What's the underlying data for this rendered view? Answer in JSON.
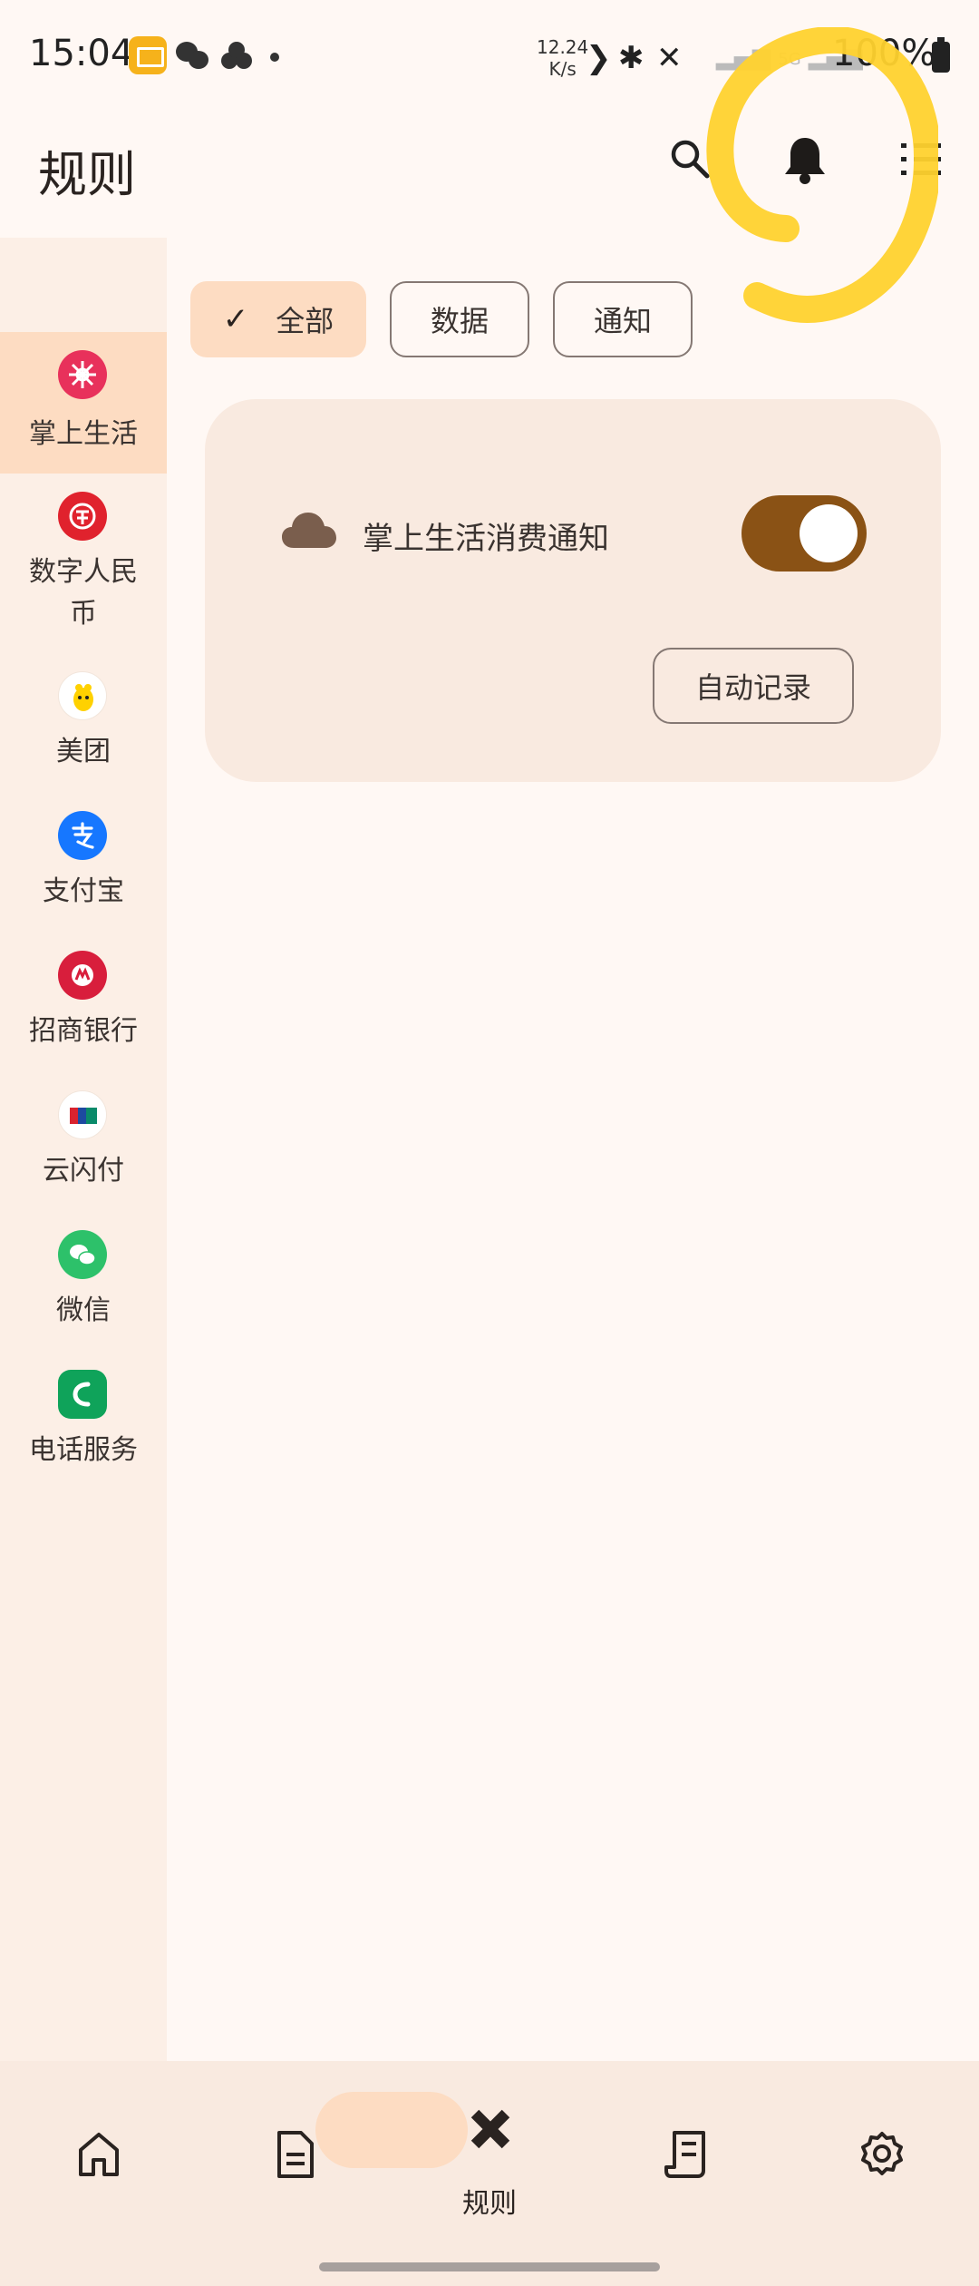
{
  "status_bar": {
    "time": "15:04",
    "speed_value": "12.24",
    "speed_unit": "K/s",
    "battery": "100%",
    "signal": "5G"
  },
  "header": {
    "title": "规则",
    "icons": [
      "search-icon",
      "bell-icon",
      "more-icon"
    ]
  },
  "sidebar": {
    "items": [
      {
        "label": "掌上生活",
        "icon": "zhangshang-icon",
        "color": "#e8315b"
      },
      {
        "label": "数字人民币",
        "icon": "ecny-icon",
        "color": "#e0222d"
      },
      {
        "label": "美团",
        "icon": "meituan-icon",
        "color": "#ffd100"
      },
      {
        "label": "支付宝",
        "icon": "alipay-icon",
        "color": "#1677ff"
      },
      {
        "label": "招商银行",
        "icon": "cmb-icon",
        "color": "#d81e3c"
      },
      {
        "label": "云闪付",
        "icon": "unionpay-icon",
        "color": "#d9232e"
      },
      {
        "label": "微信",
        "icon": "wechat-icon",
        "color": "#2dc16a"
      },
      {
        "label": "电话服务",
        "icon": "phone-icon",
        "color": "#0fa35a"
      }
    ]
  },
  "filters": {
    "all": "全部",
    "data": "数据",
    "notify": "通知"
  },
  "rule_card": {
    "label": "掌上生活消费通知",
    "enabled": true,
    "button": "自动记录"
  },
  "bottom_nav": {
    "items": [
      "home-icon",
      "document-icon",
      "rules-icon",
      "receipt-icon",
      "settings-icon"
    ],
    "active_label": "规则"
  },
  "colors": {
    "accent": "#8a5215",
    "selected_bg": "#fddcc2",
    "highlight_scribble": "#ffd22e"
  }
}
